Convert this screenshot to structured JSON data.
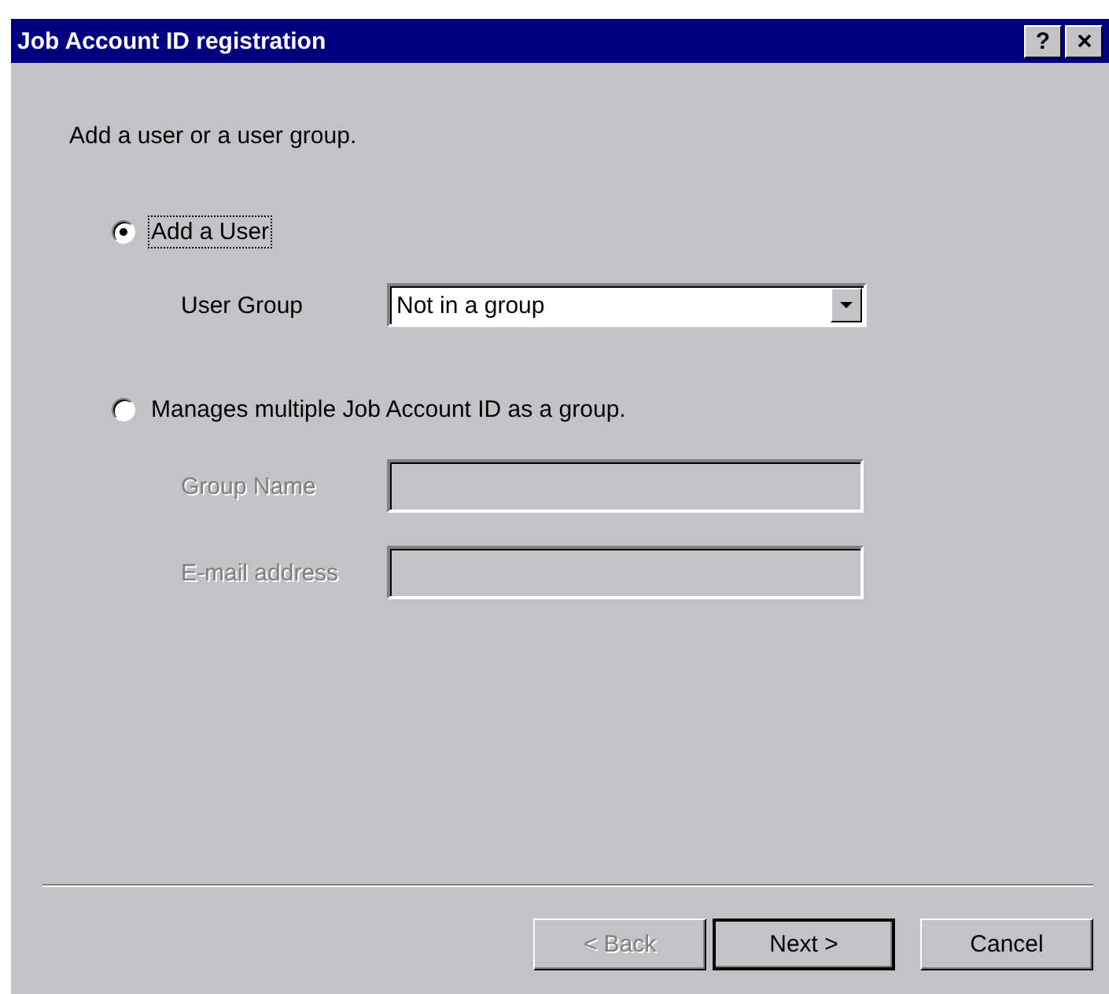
{
  "window": {
    "title": "Job Account ID registration",
    "help_button": "?"
  },
  "instruction": "Add a user or a user group.",
  "options": [
    {
      "label": "Add a User",
      "selected": true,
      "focused": true
    },
    {
      "label": "Manages multiple Job Account ID as a group.",
      "selected": false,
      "focused": false
    }
  ],
  "user_group": {
    "label": "User Group",
    "value": "Not in a group",
    "disabled": false
  },
  "group_fields": [
    {
      "label": "Group Name",
      "disabled": true
    },
    {
      "label": "E-mail address",
      "disabled": true
    }
  ],
  "buttons": [
    {
      "label": "< Back",
      "disabled": true,
      "default": false
    },
    {
      "label": "Next >",
      "disabled": false,
      "default": true
    },
    {
      "label": "Cancel",
      "disabled": false,
      "default": false
    }
  ]
}
